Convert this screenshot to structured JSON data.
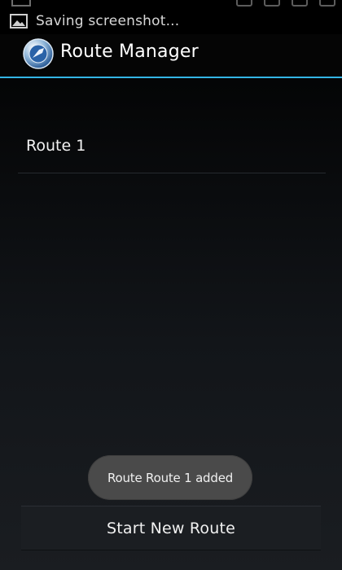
{
  "status_bar": {
    "notification_text": "Saving screenshot...",
    "notification_icon": "picture-icon"
  },
  "action_bar": {
    "title": "Route Manager",
    "app_icon": "app-icon"
  },
  "routes": [
    {
      "label": "Route 1"
    }
  ],
  "toast": {
    "text": "Route Route 1 added"
  },
  "footer": {
    "start_button_label": "Start New Route"
  },
  "colors": {
    "accent": "#33b5e5",
    "background": "#0d0f12",
    "toast_bg": "#4a4a4a"
  }
}
